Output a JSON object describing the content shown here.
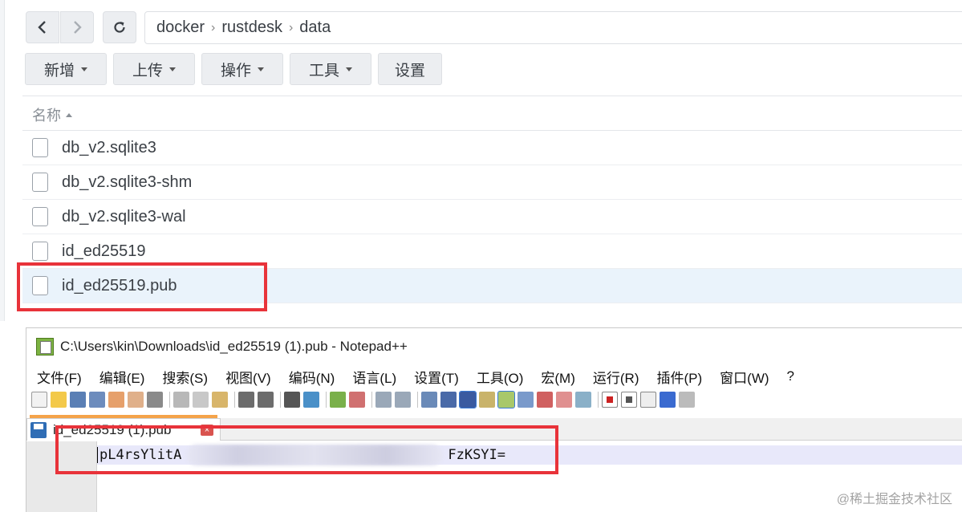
{
  "file_manager": {
    "path": [
      "docker",
      "rustdesk",
      "data"
    ],
    "toolbar": {
      "new_label": "新增",
      "upload_label": "上传",
      "action_label": "操作",
      "tools_label": "工具",
      "settings_label": "设置"
    },
    "column_header": "名称",
    "files": [
      {
        "name": "db_v2.sqlite3"
      },
      {
        "name": "db_v2.sqlite3-shm"
      },
      {
        "name": "db_v2.sqlite3-wal"
      },
      {
        "name": "id_ed25519"
      },
      {
        "name": "id_ed25519.pub",
        "selected": true
      }
    ]
  },
  "notepad": {
    "title": "C:\\Users\\kin\\Downloads\\id_ed25519 (1).pub - Notepad++",
    "menu": [
      "文件(F)",
      "编辑(E)",
      "搜索(S)",
      "视图(V)",
      "编码(N)",
      "语言(L)",
      "设置(T)",
      "工具(O)",
      "宏(M)",
      "运行(R)",
      "插件(P)",
      "窗口(W)",
      "?"
    ],
    "tab_label": "id_ed25519 (1).pub",
    "code_prefix": "pL4rsYlitA",
    "code_suffix": "FzKSYI="
  },
  "watermark": "@稀土掘金技术社区",
  "colors": {
    "highlight_red": "#e8333a",
    "selected_row": "#eaf3fb",
    "tab_accent": "#f5a34a"
  }
}
